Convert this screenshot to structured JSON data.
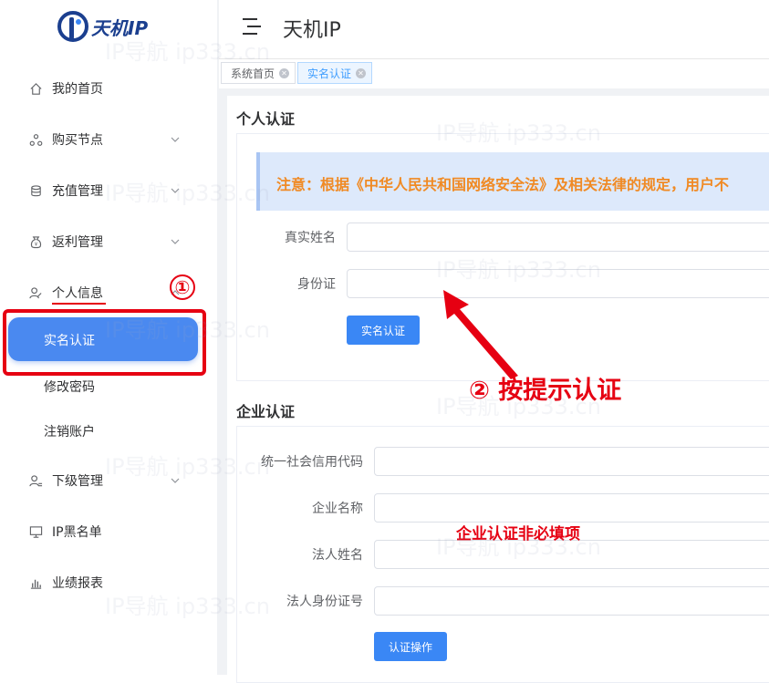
{
  "app": {
    "logo_text": "天机IP",
    "header_title": "天机IP",
    "watermark_text": "IP导航  ip333.cn"
  },
  "sidebar": {
    "items": [
      {
        "label": "我的首页",
        "icon": "home-icon"
      },
      {
        "label": "购买节点",
        "icon": "nodes-icon"
      },
      {
        "label": "充值管理",
        "icon": "database-icon"
      },
      {
        "label": "返利管理",
        "icon": "money-bag-icon"
      },
      {
        "label": "个人信息",
        "icon": "user-edit-icon"
      },
      {
        "label": "下级管理",
        "icon": "user-list-icon"
      },
      {
        "label": "IP黑名单",
        "icon": "monitor-icon"
      },
      {
        "label": "业绩报表",
        "icon": "bar-chart-icon"
      }
    ],
    "sub_items": [
      "实名认证",
      "修改密码",
      "注销账户"
    ],
    "annotation_number": "①"
  },
  "tabs": [
    {
      "label": "系统首页",
      "active": false
    },
    {
      "label": "实名认证",
      "active": true
    }
  ],
  "personal": {
    "title": "个人认证",
    "notice": "注意：根据《中华人民共和国网络安全法》及相关法律的规定，用户不",
    "fields": [
      {
        "label": "真实姓名",
        "value": ""
      },
      {
        "label": "身份证",
        "value": ""
      }
    ],
    "button": "实名认证",
    "annotation": "② 按提示认证"
  },
  "enterprise": {
    "title": "企业认证",
    "fields": [
      {
        "label": "统一社会信用代码",
        "value": ""
      },
      {
        "label": "企业名称",
        "value": ""
      },
      {
        "label": "法人姓名",
        "value": ""
      },
      {
        "label": "法人身份证号",
        "value": ""
      }
    ],
    "button": "认证操作",
    "annotation": "企业认证非必填项"
  },
  "colors": {
    "accent": "#3a87f5",
    "annotation_red": "#e60012",
    "notice_text": "#f08a24",
    "notice_bg": "#dde9fb"
  }
}
